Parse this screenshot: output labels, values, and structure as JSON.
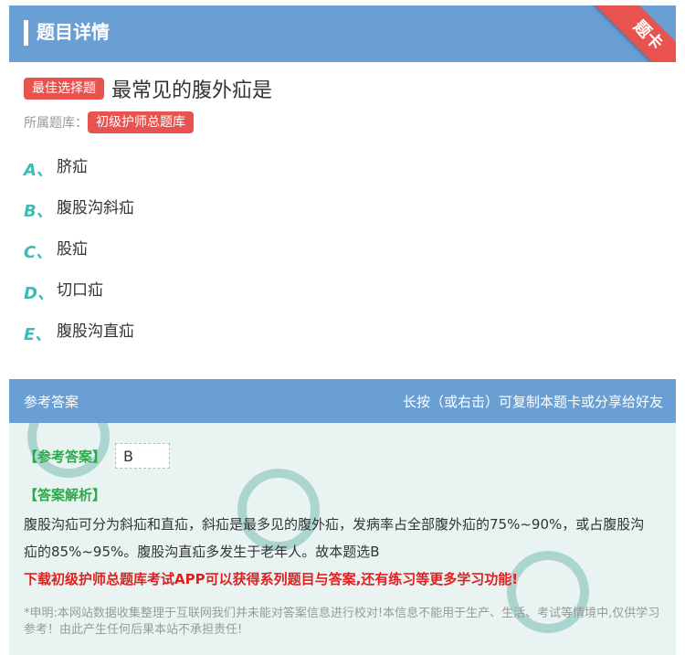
{
  "header": {
    "title": "题目详情",
    "corner_ribbon": "题卡"
  },
  "question": {
    "type_tag": "最佳选择题",
    "text": "最常见的腹外疝是",
    "bank_label": "所属题库：",
    "bank_name": "初级护师总题库"
  },
  "options": [
    {
      "letter": "A、",
      "text": "脐疝"
    },
    {
      "letter": "B、",
      "text": "腹股沟斜疝"
    },
    {
      "letter": "C、",
      "text": "股疝"
    },
    {
      "letter": "D、",
      "text": "切口疝"
    },
    {
      "letter": "E、",
      "text": "腹股沟直疝"
    }
  ],
  "answer_section": {
    "title": "参考答案",
    "hint": "长按（或右击）可复制本题卡或分享给好友",
    "answer_label": "【参考答案】",
    "answer_value": "B",
    "analysis_label": "【答案解析】",
    "analysis_text": "腹股沟疝可分为斜疝和直疝，斜疝是最多见的腹外疝，发病率占全部腹外疝的75%~90%，或占腹股沟疝的85%~95%。腹股沟直疝多发生于老年人。故本题选B",
    "promo": "下载初级护师总题库考试APP可以获得系列题目与答案,还有练习等更多学习功能!",
    "disclaimer": "*申明:本网站数据收集整理于互联网我们并未能对答案信息进行校对!本信息不能用于生产、生活、考试等情境中,仅供学习参考！由此产生任何后果本站不承担责任!"
  },
  "colors": {
    "header_bg": "#6a9fd4",
    "accent_red": "#e8534f",
    "option_letter": "#3bbdb5",
    "answer_green": "#2aa84a",
    "promo_red": "#e02020",
    "answer_bg": "#e9f4f2"
  }
}
